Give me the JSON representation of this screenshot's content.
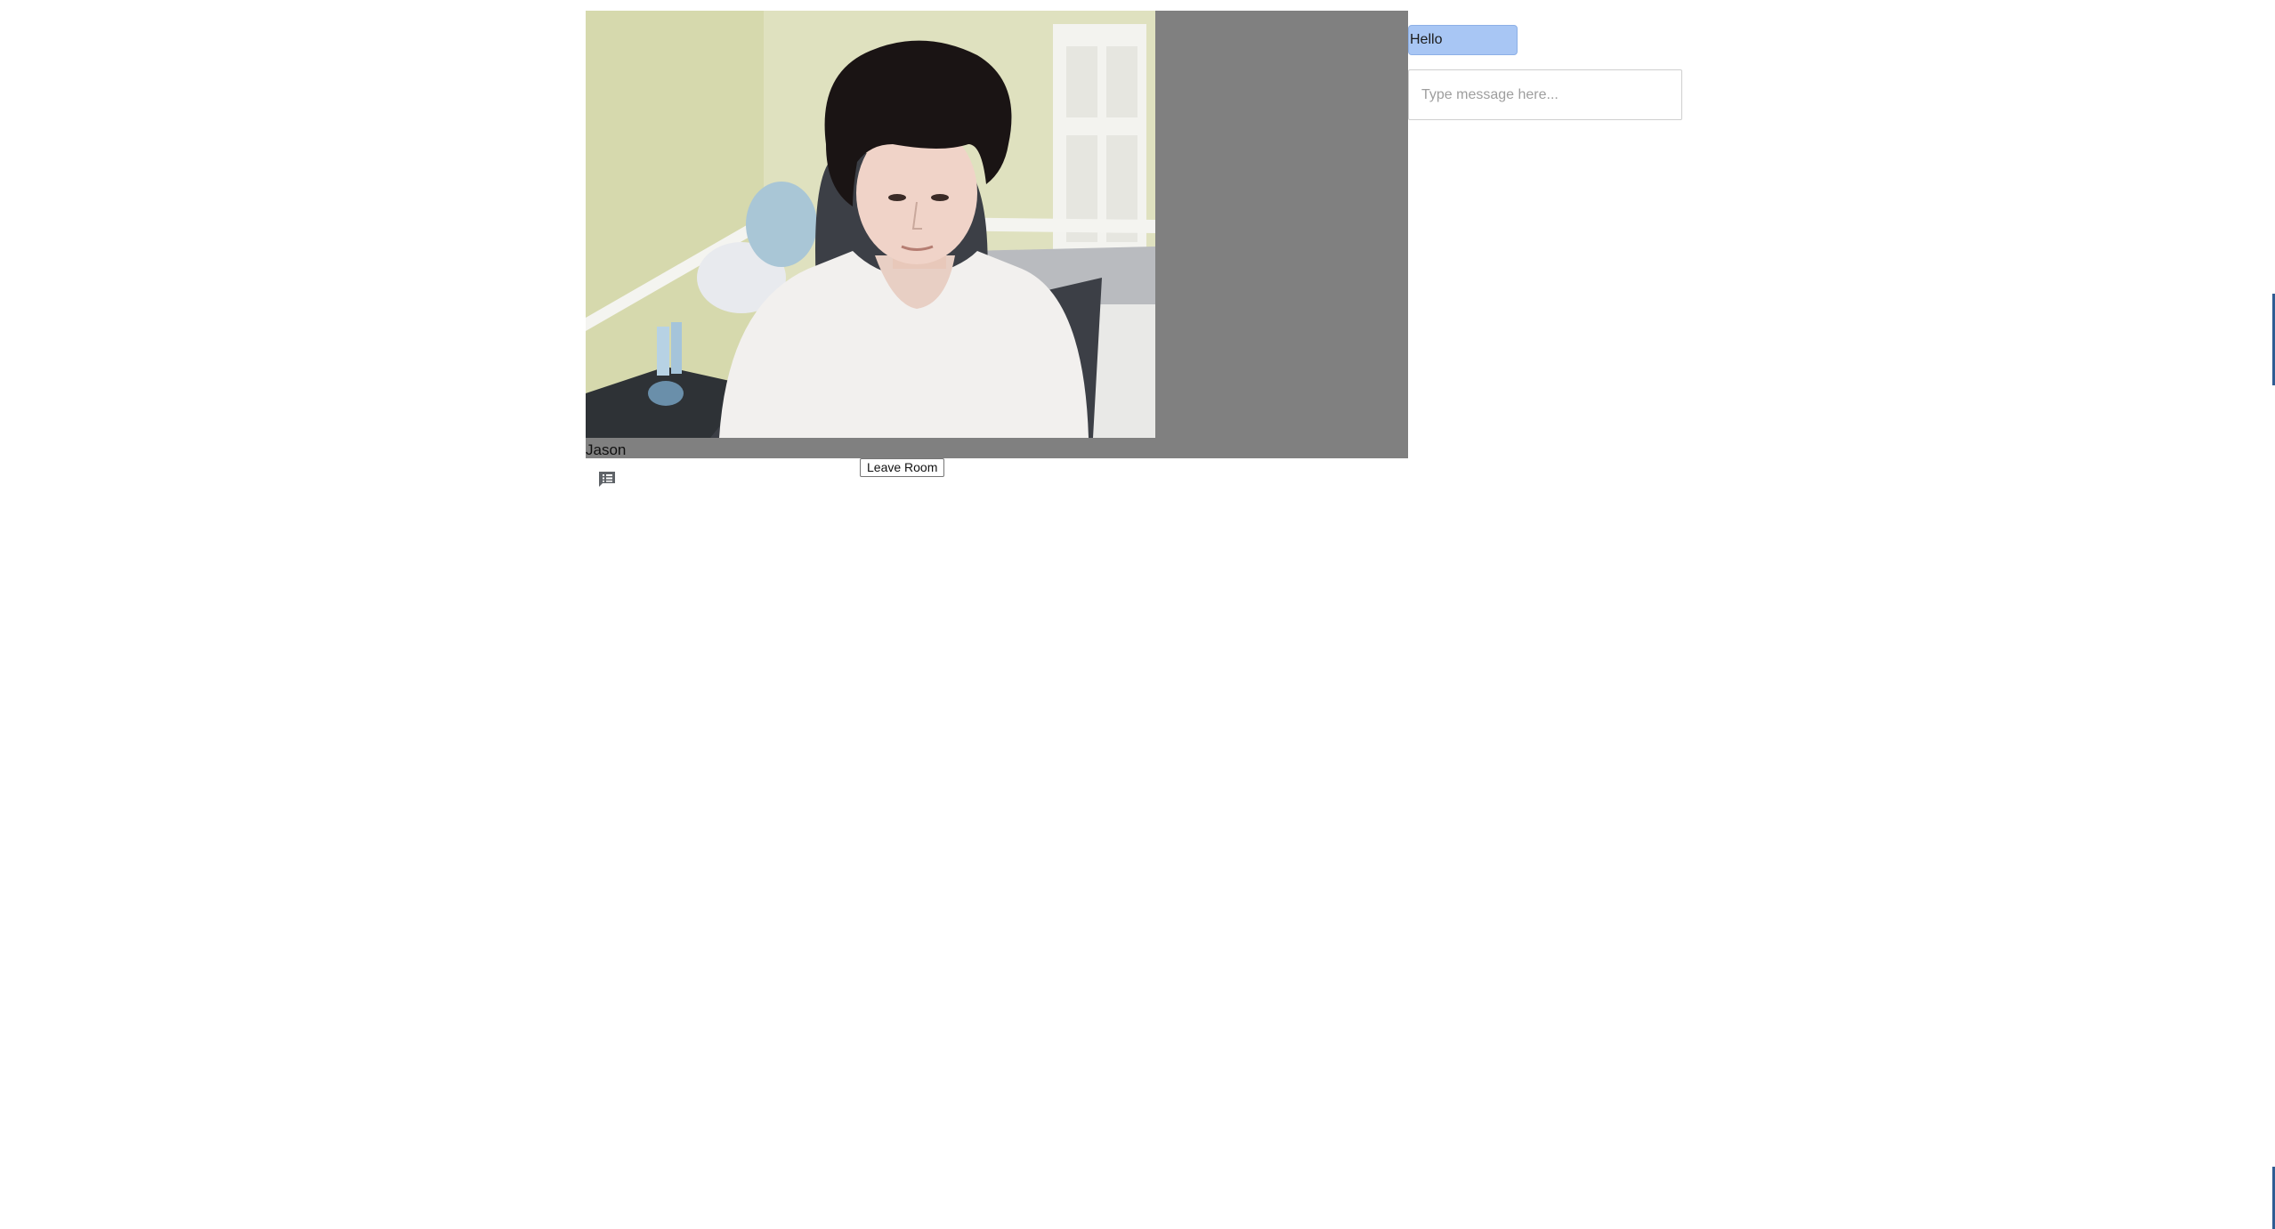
{
  "video": {
    "participant_name": "Jason"
  },
  "controls": {
    "leave_label": "Leave Room",
    "chat_icon": "chat-list-icon"
  },
  "chat": {
    "messages": [
      {
        "text": "Hello"
      }
    ],
    "input_placeholder": "Type message here...",
    "input_value": ""
  },
  "colors": {
    "video_panel_bg": "#808080",
    "message_bubble_bg": "#a8c6f4"
  }
}
